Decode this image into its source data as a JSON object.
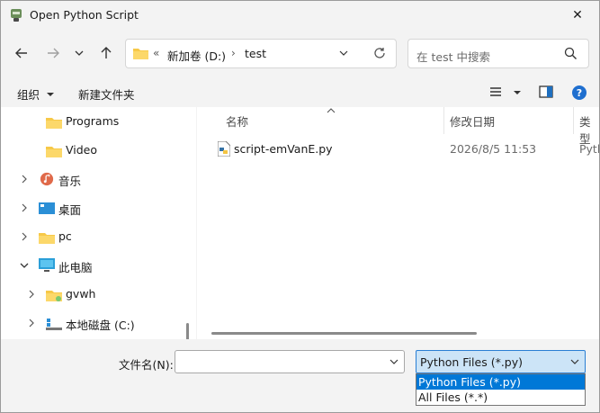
{
  "window": {
    "title": "Open Python Script",
    "close_glyph": "✕"
  },
  "nav": {
    "back_icon": "arrow-left-icon",
    "forward_icon": "arrow-right-icon",
    "recent_icon": "chevron-down-icon",
    "up_icon": "arrow-up-icon"
  },
  "address": {
    "overflow": "«",
    "crumbs": [
      "新加卷 (D:)",
      "test"
    ],
    "separator": "›"
  },
  "search": {
    "placeholder": "在 test 中搜索"
  },
  "toolbar": {
    "organize_label": "组织",
    "new_folder_label": "新建文件夹"
  },
  "tree": {
    "items": [
      {
        "label": "Programs",
        "icon": "folder-icon"
      },
      {
        "label": "Video",
        "icon": "folder-icon"
      },
      {
        "label": "音乐",
        "icon": "music-icon"
      },
      {
        "label": "桌面",
        "icon": "desktop-icon"
      },
      {
        "label": "pc",
        "icon": "folder-icon"
      },
      {
        "label": "此电脑",
        "icon": "computer-icon"
      },
      {
        "label": "gvwh",
        "icon": "folder-icon"
      },
      {
        "label": "本地磁盘 (C:)",
        "icon": "drive-icon"
      }
    ]
  },
  "files": {
    "columns": {
      "name": "名称",
      "modified": "修改日期",
      "type": "类型"
    },
    "rows": [
      {
        "name": "script-emVanE.py",
        "modified": "2026/8/5 11:53",
        "type": "Pyth"
      }
    ]
  },
  "bottom": {
    "filename_label": "文件名(N):",
    "filename_value": "",
    "filetype_selected": "Python Files (*.py)",
    "filetype_options": [
      "Python Files (*.py)",
      "All Files (*.*)"
    ]
  },
  "colors": {
    "accent": "#0078d7",
    "selected_bg": "#cce4f7",
    "folder": "#f7c948"
  }
}
